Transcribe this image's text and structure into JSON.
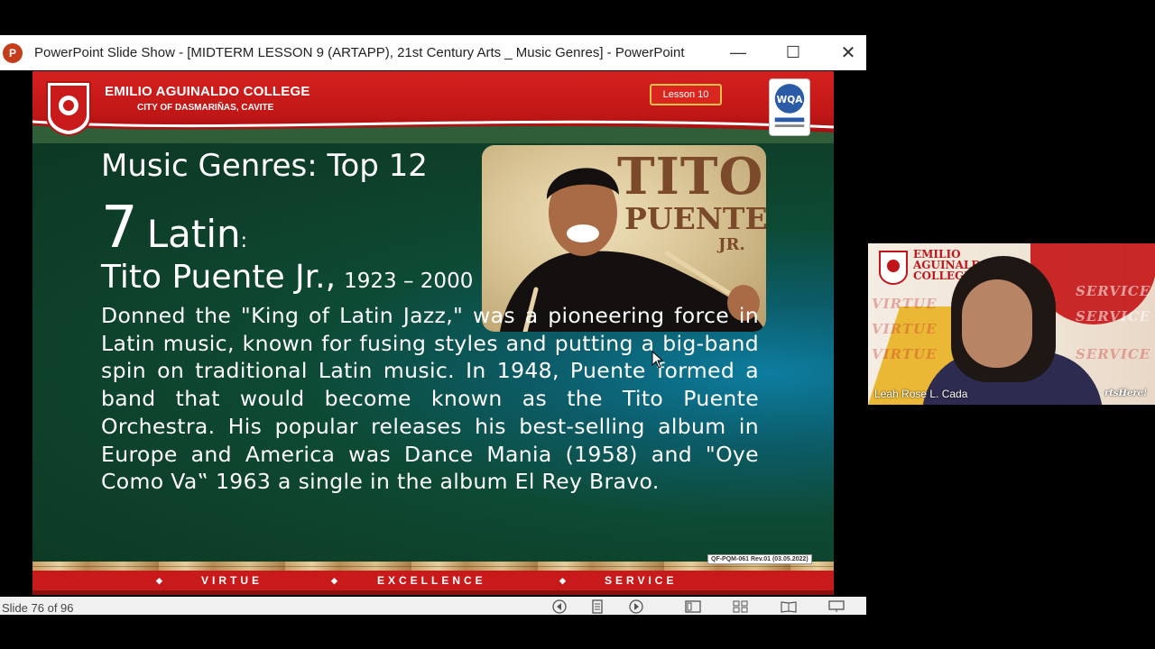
{
  "window": {
    "title": "PowerPoint Slide Show - [MIDTERM LESSON 9 (ARTAPP), 21st Century Arts _ Music Genres] - PowerPoint",
    "app_icon_letter": "P",
    "minimize_glyph": "—",
    "maximize_glyph": "☐",
    "close_glyph": "✕"
  },
  "slide": {
    "header": {
      "college_name": "EMILIO AGUINALDO COLLEGE",
      "college_location": "CITY OF DASMARIÑAS, CAVITE",
      "lesson_badge": "Lesson 10",
      "certification_logo_text": "WQA"
    },
    "title": "Music Genres: Top 12",
    "genre_number": "7",
    "genre_name": "Latin",
    "genre_colon": ":",
    "artist_name": "Tito Puente Jr.,",
    "artist_years": "1923 – 2000",
    "description": "Donned the \"King of Latin Jazz,\" was a pioneering force in Latin music, known for fusing styles and putting a big-band spin on traditional Latin music. In 1948, Puente formed a band that would become known as the Tito Puente Orchestra. His popular releases his best-selling album in Europe and America was Dance Mania (1958) and \"Oye Como Va‟ 1963 a single in the album El Rey Bravo.",
    "photo": {
      "title_line1": "TITO",
      "title_line2": "PUENTE",
      "title_line3": "JR."
    },
    "form_code": "QF-PQM-061 Rev.01 (03.05.2022)",
    "footer": {
      "word1": "VIRTUE",
      "word2": "EXCELLENCE",
      "word3": "SERVICE",
      "diamond": "◆"
    }
  },
  "statusbar": {
    "slide_counter": "Slide 76 of 96",
    "icons": [
      "previous-icon",
      "notes-icon",
      "next-icon",
      "normal-view-icon",
      "slide-sorter-icon",
      "reading-view-icon",
      "slideshow-icon"
    ]
  },
  "video_tile": {
    "speaker_name": "Leah Rose L. Cada",
    "college_name_line1": "EMILIO",
    "college_name_line2": "AGUINALDO",
    "college_name_line3": "COLLEGE",
    "background_words": [
      "VIRTUE",
      "SERVICE"
    ],
    "corner_text": "rtsHere!"
  },
  "colors": {
    "header_red": "#c81a1a",
    "slide_green": "#0e402a",
    "badge_border": "#f1c14a"
  }
}
